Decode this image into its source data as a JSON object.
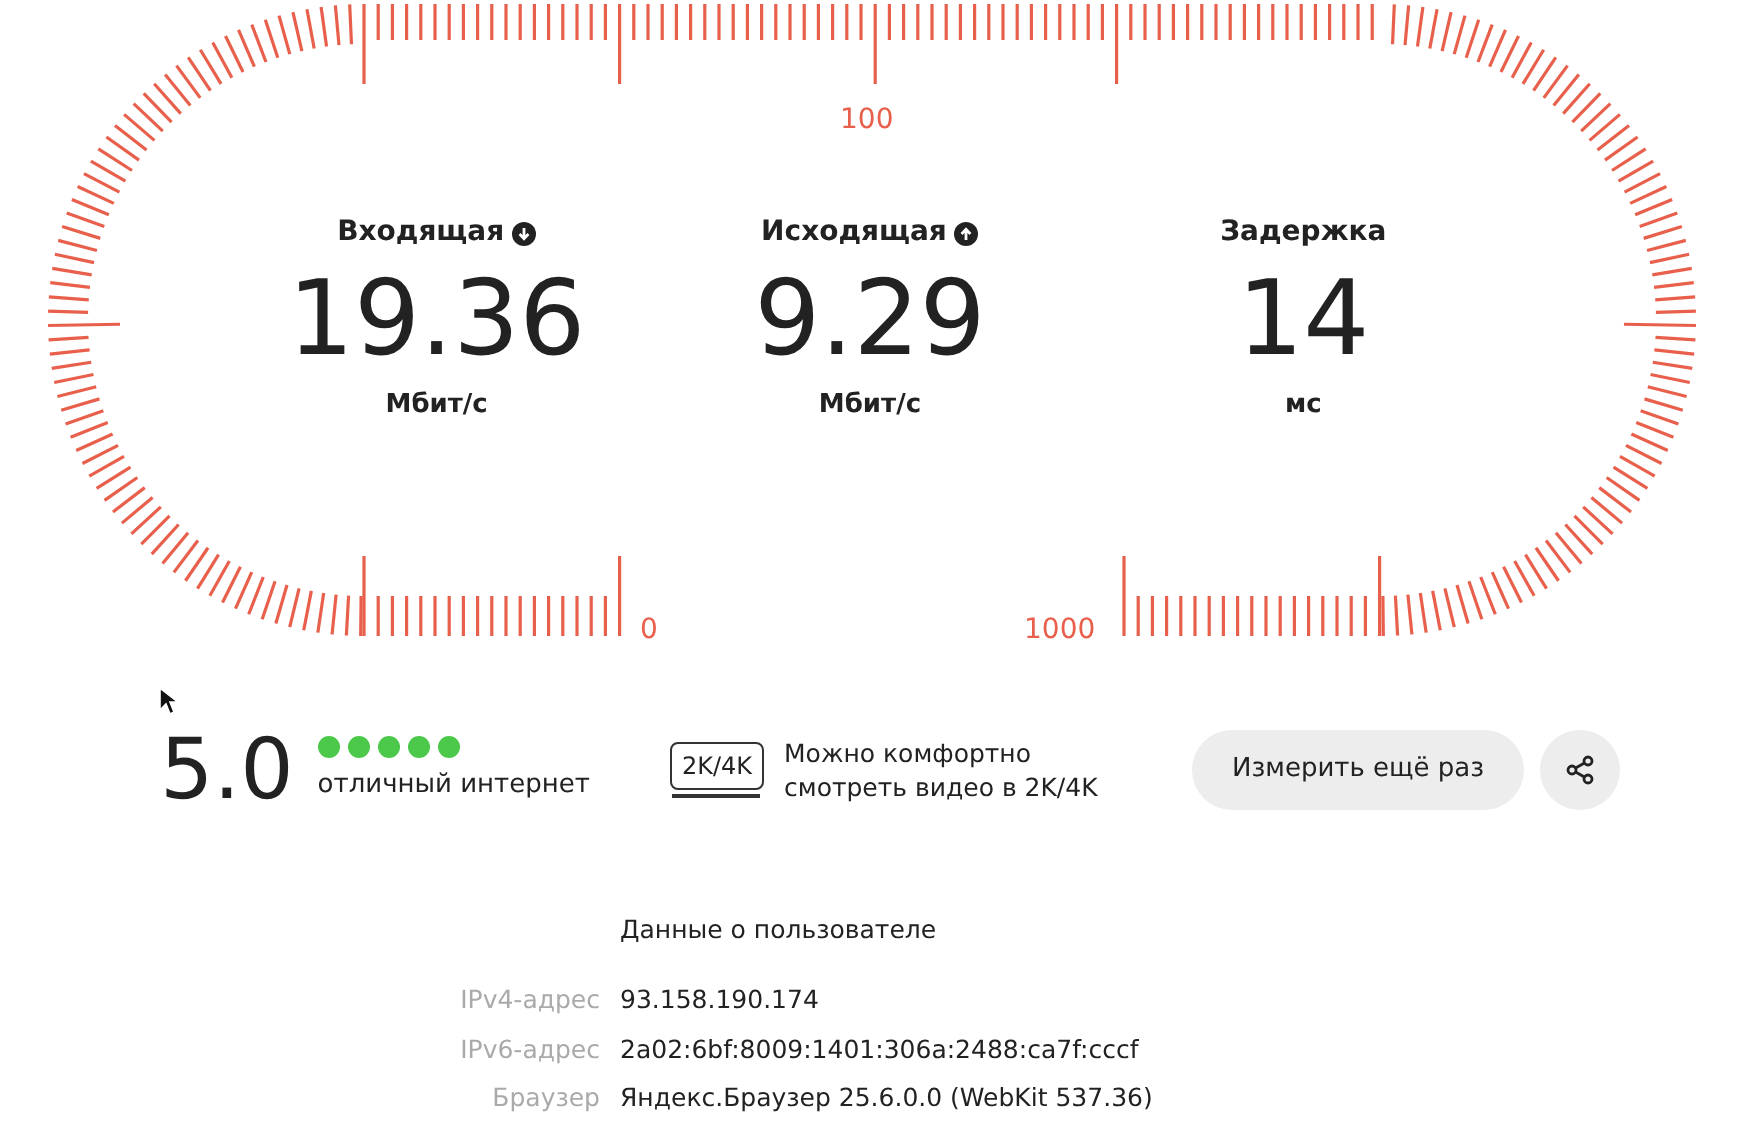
{
  "gauge": {
    "scale_labels": [
      "100",
      "0",
      "1000"
    ]
  },
  "metrics": [
    {
      "label": "Входящая",
      "kind": "download",
      "value": "19.36",
      "unit": "Мбит/с"
    },
    {
      "label": "Исходящая",
      "kind": "upload",
      "value": "9.29",
      "unit": "Мбит/с"
    },
    {
      "label": "Задержка",
      "kind": "plain",
      "value": "14",
      "unit": "мс"
    }
  ],
  "rating": {
    "score": "5.0",
    "stars": 5,
    "text": "отличный интернет"
  },
  "quality": {
    "badge": "2K/4K",
    "text": "Можно комфортно смотреть видео в 2K/4K"
  },
  "buttons": {
    "retest": "Измерить ещё раз"
  },
  "user_data": {
    "title": "Данные о пользователе",
    "rows": [
      {
        "label": "IPv4-адрес",
        "value": "93.158.190.174"
      },
      {
        "label": "IPv6-адрес",
        "value": "2a02:6bf:8009:1401:306a:2488:ca7f:cccf"
      },
      {
        "label": "Браузер",
        "value": "Яндекс.Браузер 25.6.0.0 (WebKit 537.36)"
      }
    ]
  }
}
